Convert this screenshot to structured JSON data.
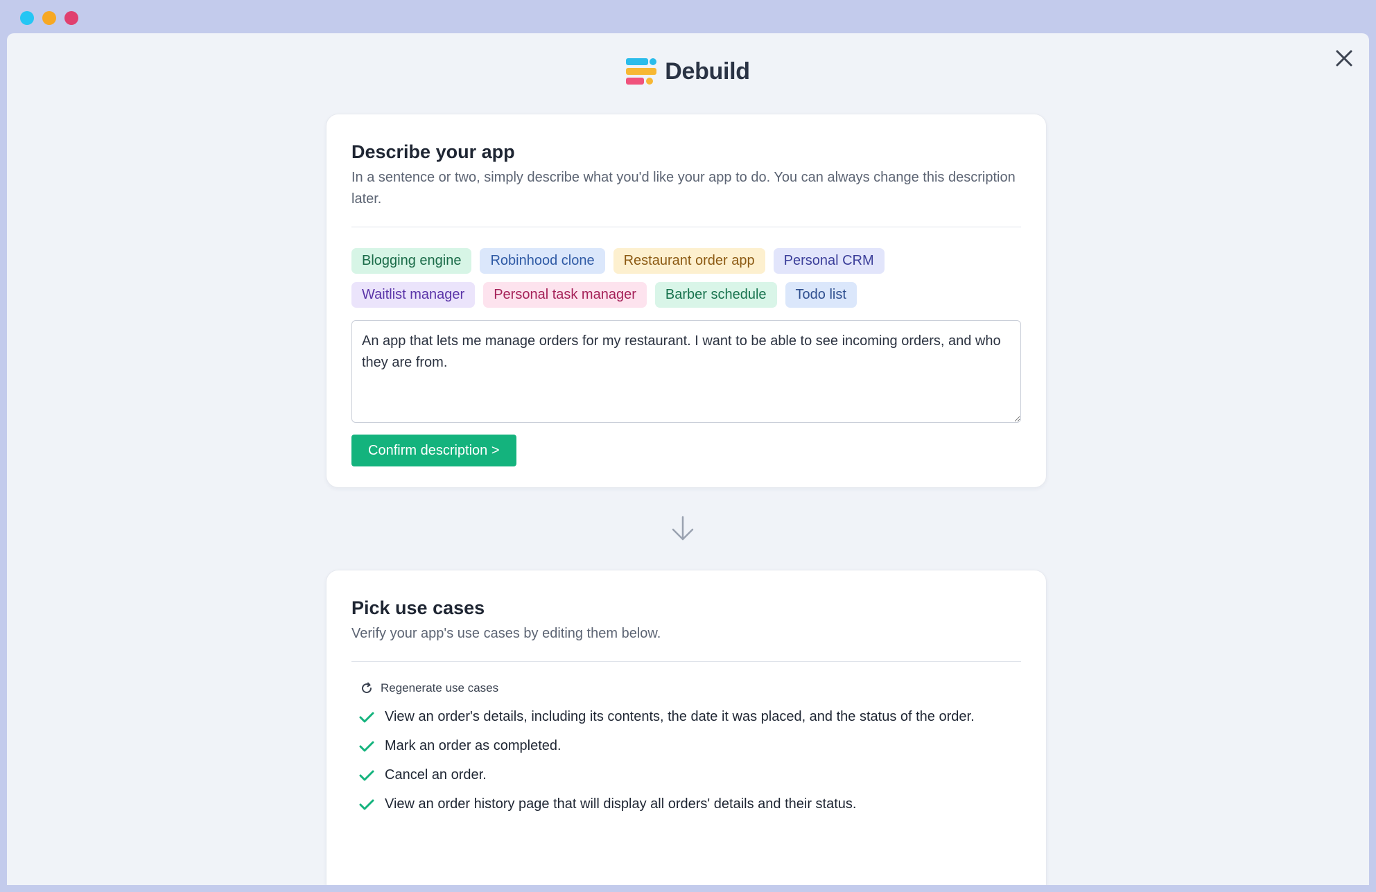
{
  "window": {
    "traffic_lights": [
      {
        "name": "close",
        "color": "#25c6f4"
      },
      {
        "name": "minimize",
        "color": "#f7a823"
      },
      {
        "name": "maximize",
        "color": "#e0406f"
      }
    ]
  },
  "brand": {
    "name": "Debuild",
    "logo_colors": [
      "#2bbcea",
      "#f7b733",
      "#f0527c",
      "#2bbcea"
    ]
  },
  "describe": {
    "title": "Describe your app",
    "subtitle": "In a sentence or two, simply describe what you'd like your app to do. You can always change this description later.",
    "chips": [
      {
        "label": "Blogging engine",
        "bg": "#d7f5e6",
        "fg": "#1a6b48"
      },
      {
        "label": "Robinhood clone",
        "bg": "#dbe7fb",
        "fg": "#2f5aa5"
      },
      {
        "label": "Restaurant order app",
        "bg": "#fdf0cf",
        "fg": "#8c5a13"
      },
      {
        "label": "Personal CRM",
        "bg": "#e2e5fb",
        "fg": "#3c3f9a"
      },
      {
        "label": "Waitlist manager",
        "bg": "#ebe4fb",
        "fg": "#5a34a8"
      },
      {
        "label": "Personal task manager",
        "bg": "#fde3ee",
        "fg": "#a52158"
      },
      {
        "label": "Barber schedule",
        "bg": "#d9f5e8",
        "fg": "#18734e"
      },
      {
        "label": "Todo list",
        "bg": "#dbe7fb",
        "fg": "#2f4f8f"
      }
    ],
    "textarea_value": "An app that lets me manage orders for my restaurant. I want to be able to see incoming orders, and who they are from.",
    "confirm_label": "Confirm description  >"
  },
  "usecases": {
    "title": "Pick use cases",
    "subtitle": "Verify your app's use cases by editing them below.",
    "regenerate_label": "Regenerate use cases",
    "items": [
      "View an order's details, including its contents, the date it was placed, and the status of the order.",
      "Mark an order as completed.",
      "Cancel an order.",
      "View an order history page that will display all orders' details and their status."
    ],
    "accent_color": "#14b37d"
  }
}
